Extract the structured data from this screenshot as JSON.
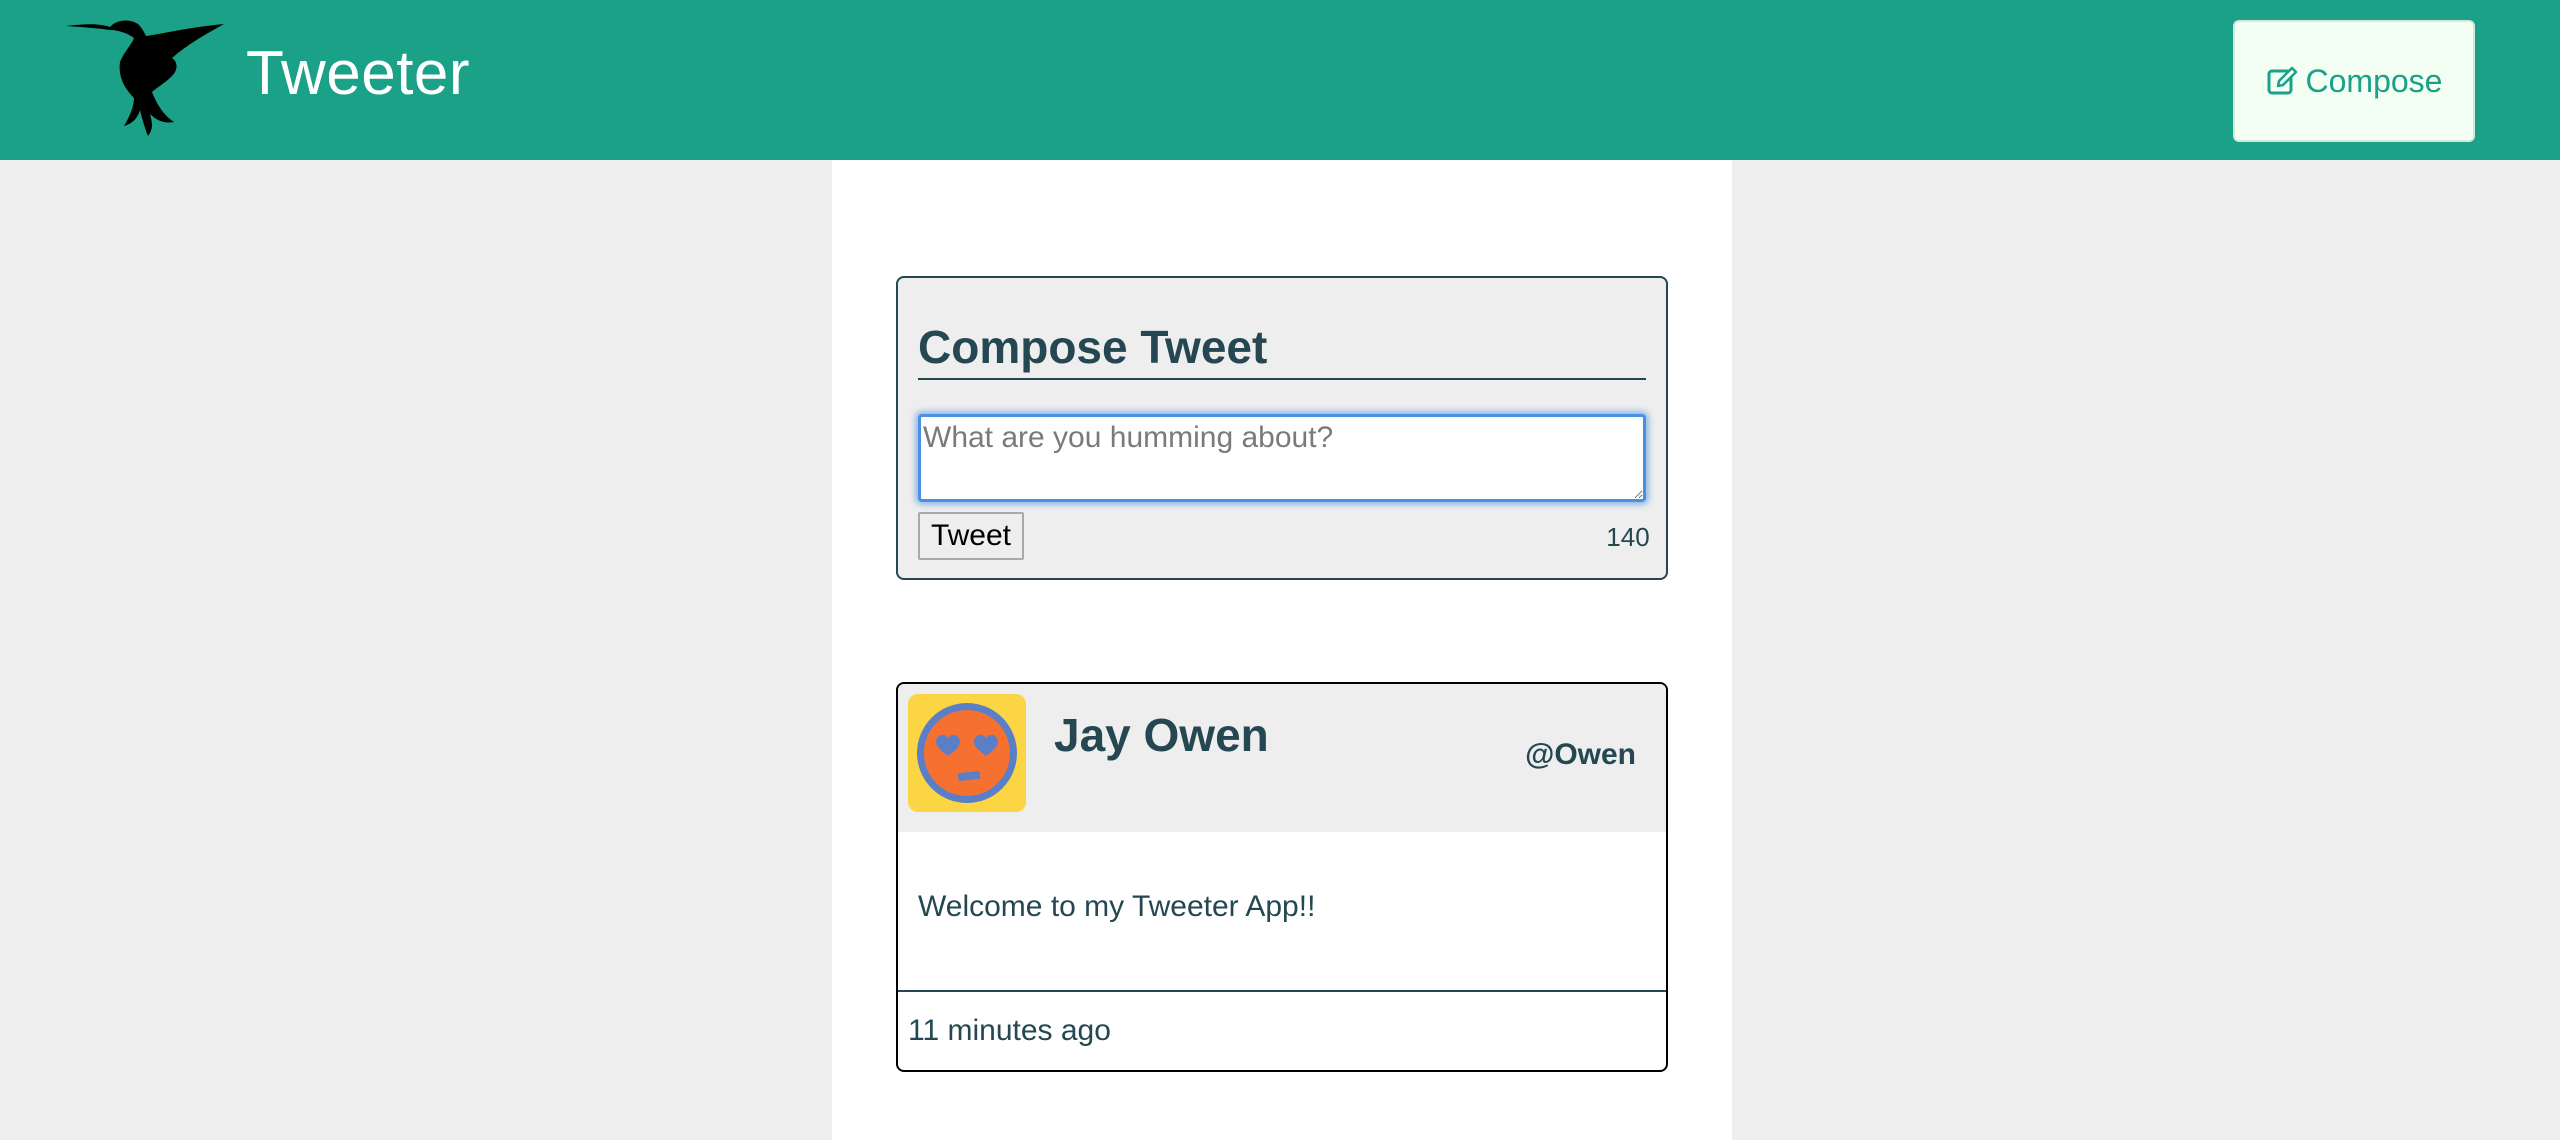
{
  "nav": {
    "brand": "Tweeter",
    "logo_icon": "hummingbird-icon",
    "compose_icon": "edit-icon",
    "compose_label": "Compose"
  },
  "new_tweet": {
    "heading": "Compose Tweet",
    "placeholder": "What are you humming about?",
    "submit_label": "Tweet",
    "counter": "140"
  },
  "tweets": [
    {
      "name": "Jay Owen",
      "handle": "@Owen",
      "avatar_icon": "heart-eyes-emoji-avatar",
      "content": "Welcome to my Tweeter App!!",
      "time": "11 minutes ago"
    }
  ],
  "colors": {
    "nav_bg": "#1aa187",
    "text": "#244751",
    "page_bg": "#eeeeee",
    "focus": "#4a90e2"
  }
}
